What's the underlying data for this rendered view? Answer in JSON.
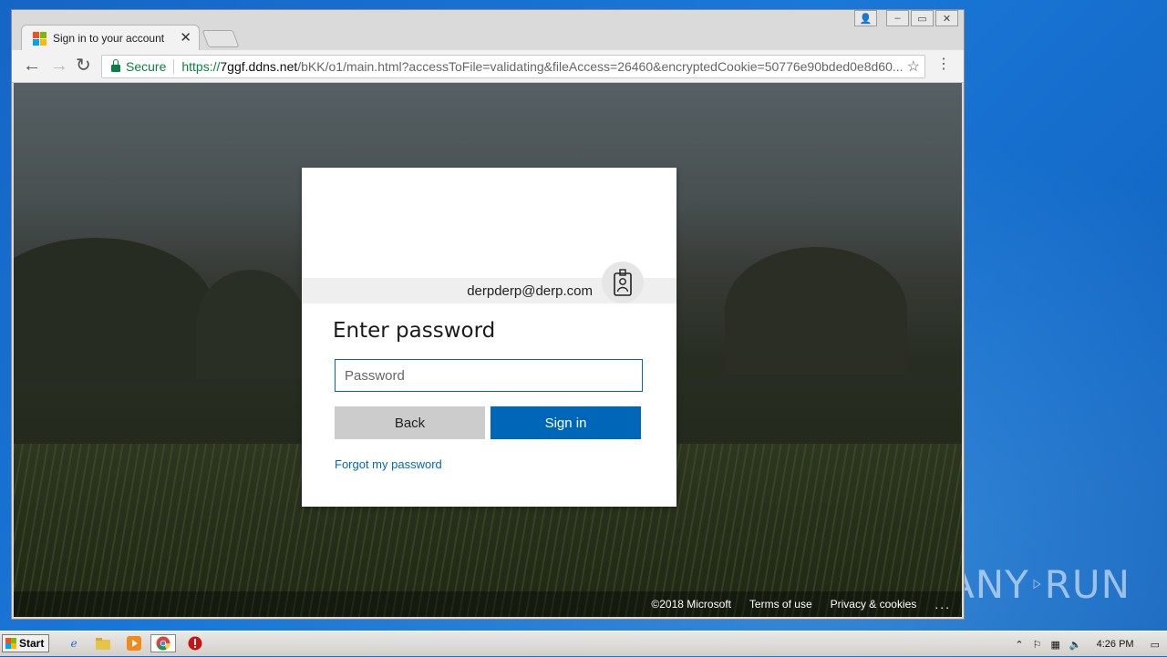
{
  "browser": {
    "tab": {
      "title": "Sign in to your account"
    },
    "address": {
      "secure_label": "Secure",
      "url_scheme": "https://",
      "url_host": "7ggf.ddns.net",
      "url_rest": "/bKK/o1/main.html?accessToFile=validating&fileAccess=26460&encryptedCookie=50776e90bded0e8d60..."
    }
  },
  "login": {
    "account": "derpderp@derp.com",
    "title": "Enter password",
    "password_placeholder": "Password",
    "back_label": "Back",
    "signin_label": "Sign in",
    "forgot_label": "Forgot my password"
  },
  "footer": {
    "copyright": "©2018 Microsoft",
    "terms": "Terms of use",
    "privacy": "Privacy & cookies",
    "more": "..."
  },
  "taskbar": {
    "start_label": "Start",
    "clock": "4:26 PM"
  },
  "watermark": {
    "left": "ANY",
    "right": "RUN"
  },
  "colors": {
    "accent": "#0067b8",
    "secure_green": "#0b8043",
    "ms_red": "#f25022",
    "ms_green": "#7fba00",
    "ms_blue": "#00a4ef",
    "ms_yellow": "#ffb900"
  }
}
